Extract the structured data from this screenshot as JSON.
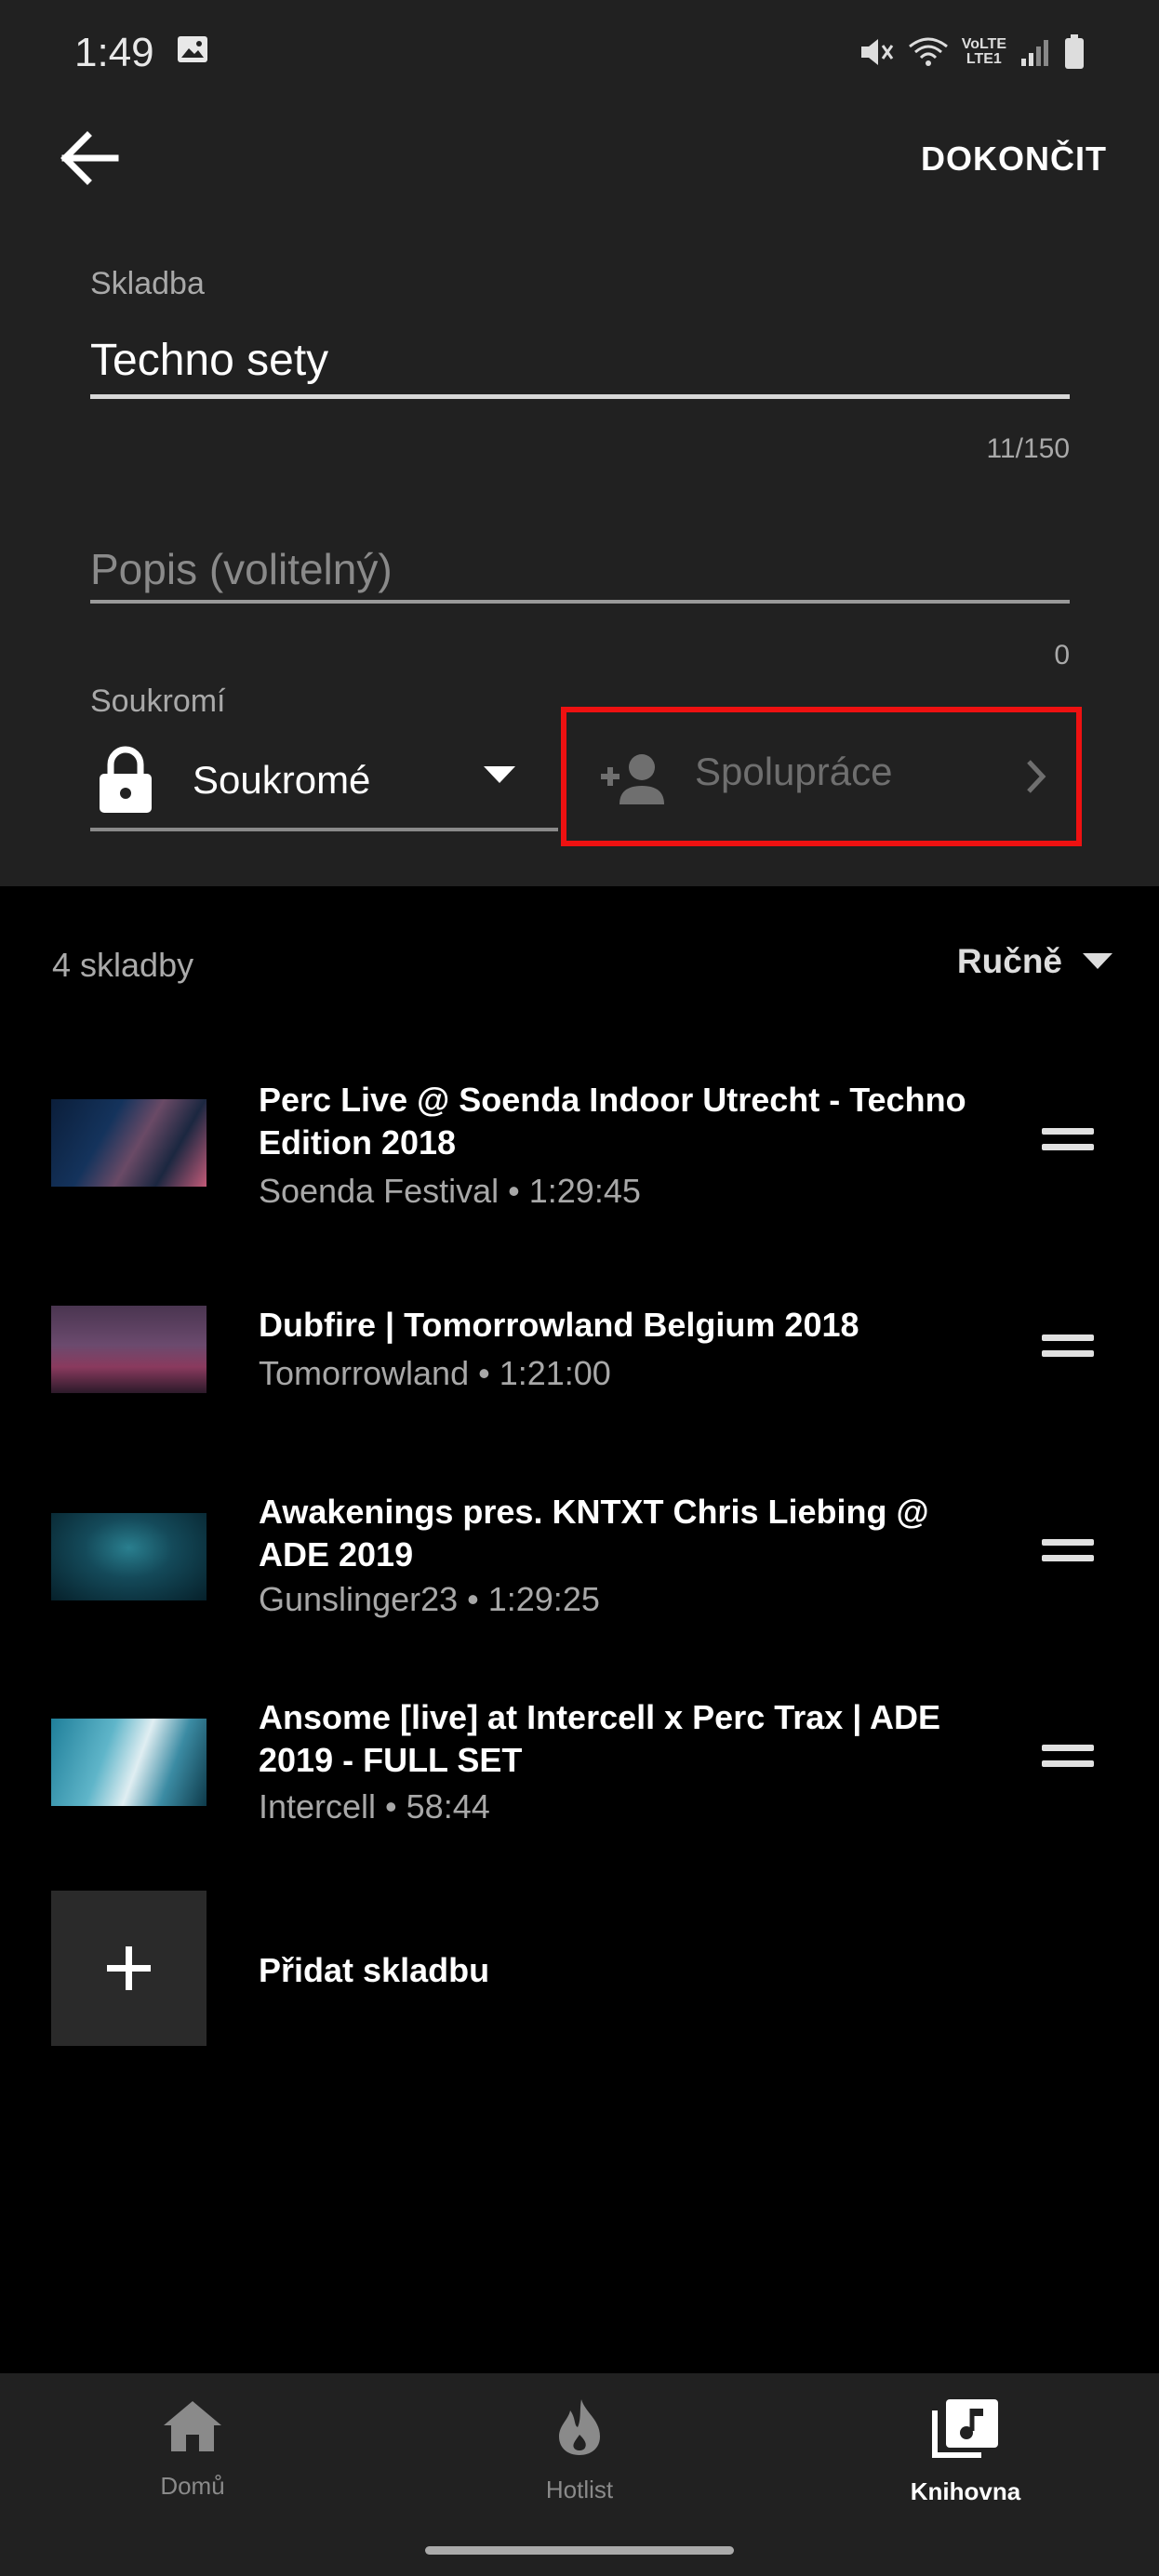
{
  "status_bar": {
    "time": "1:49",
    "network_label_top": "VoLTE",
    "network_label_bottom": "LTE1",
    "icons": [
      "gallery-icon",
      "mute-icon",
      "wifi-icon",
      "signal-icon",
      "battery-icon"
    ]
  },
  "header": {
    "back_icon": "arrow-back-icon",
    "finish_label": "DOKONČIT"
  },
  "form": {
    "title_label": "Skladba",
    "title_value": "Techno sety",
    "title_counter": "11/150",
    "description_placeholder": "Popis (volitelný)",
    "description_counter": "0",
    "privacy_label": "Soukromí",
    "privacy_value": "Soukromé",
    "collaboration_label": "Spolupráce"
  },
  "playlist": {
    "count_text": "4 skladby",
    "sort_label": "Ručně",
    "tracks": [
      {
        "title": "Perc Live @ Soenda Indoor Utrecht - Techno Edition 2018",
        "subtitle": "Soenda Festival • 1:29:45"
      },
      {
        "title": "Dubfire | Tomorrowland Belgium 2018",
        "subtitle": "Tomorrowland • 1:21:00"
      },
      {
        "title": "Awakenings pres. KNTXT Chris Liebing @ ADE 2019",
        "subtitle": "Gunslinger23 • 1:29:25"
      },
      {
        "title": "Ansome [live] at Intercell x Perc Trax | ADE 2019 - FULL SET",
        "subtitle": "Intercell • 58:44"
      }
    ],
    "add_label": "Přidat skladbu"
  },
  "bottom_nav": {
    "items": [
      {
        "label": "Domů",
        "icon": "home-icon",
        "active": false
      },
      {
        "label": "Hotlist",
        "icon": "flame-icon",
        "active": false
      },
      {
        "label": "Knihovna",
        "icon": "library-icon",
        "active": true
      }
    ]
  },
  "colors": {
    "background": "#000000",
    "panel": "#212121",
    "highlight_box": "#ee1111",
    "text_secondary": "#a9a9a9"
  }
}
